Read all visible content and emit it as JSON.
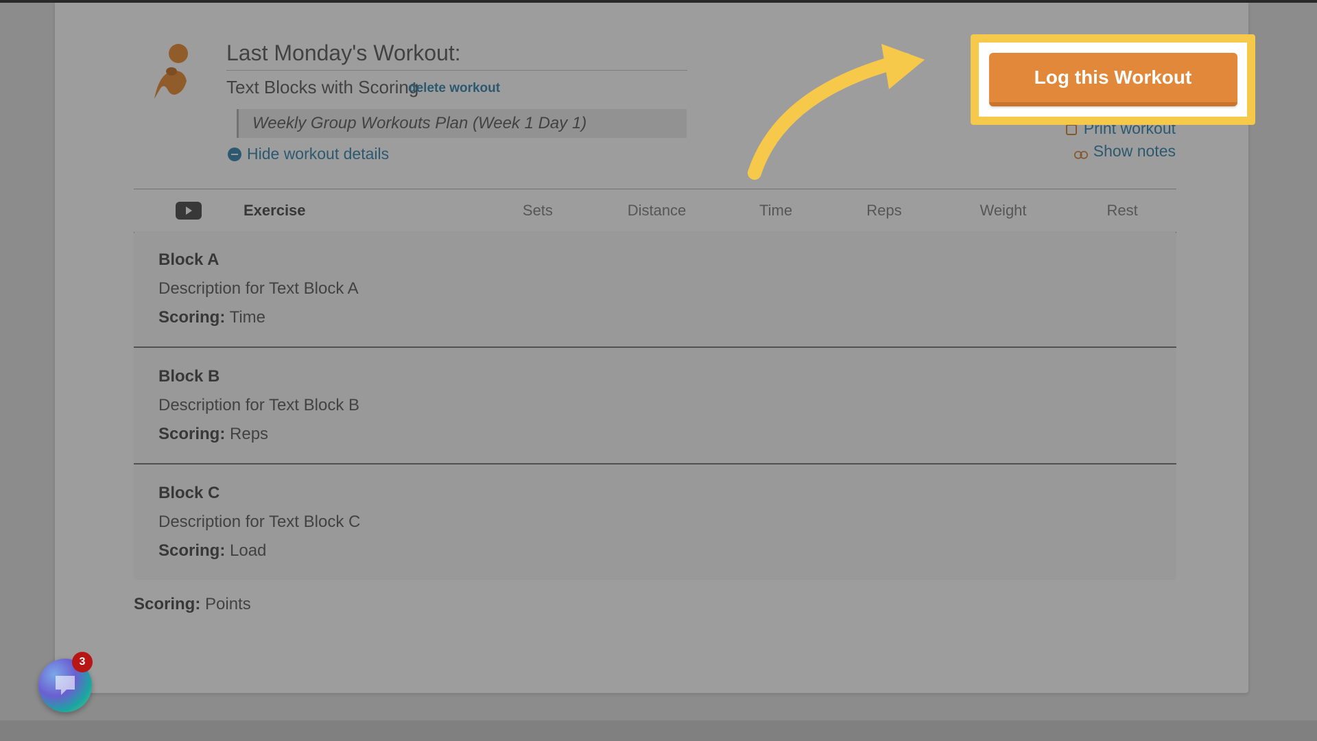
{
  "header": {
    "title": "Last Monday's Workout:",
    "subtitle": "Text Blocks with Scoring",
    "delete_link": "delete workout",
    "plan_label": "Weekly Group Workouts Plan (Week 1 Day 1)",
    "hide_details": "Hide workout details"
  },
  "actions": {
    "log_button": "Log this Workout",
    "print": "Print workout",
    "notes": "Show notes"
  },
  "table": {
    "columns": {
      "exercise": "Exercise",
      "sets": "Sets",
      "distance": "Distance",
      "time": "Time",
      "reps": "Reps",
      "weight": "Weight",
      "rest": "Rest"
    }
  },
  "blocks": [
    {
      "title": "Block A",
      "description": "Description for Text Block A",
      "scoring_label": "Scoring:",
      "scoring": "Time"
    },
    {
      "title": "Block B",
      "description": "Description for Text Block B",
      "scoring_label": "Scoring:",
      "scoring": "Reps"
    },
    {
      "title": "Block C",
      "description": "Description for Text Block C",
      "scoring_label": "Scoring:",
      "scoring": "Load"
    }
  ],
  "overall": {
    "scoring_label": "Scoring:",
    "scoring": "Points"
  },
  "chat": {
    "badge": "3"
  }
}
